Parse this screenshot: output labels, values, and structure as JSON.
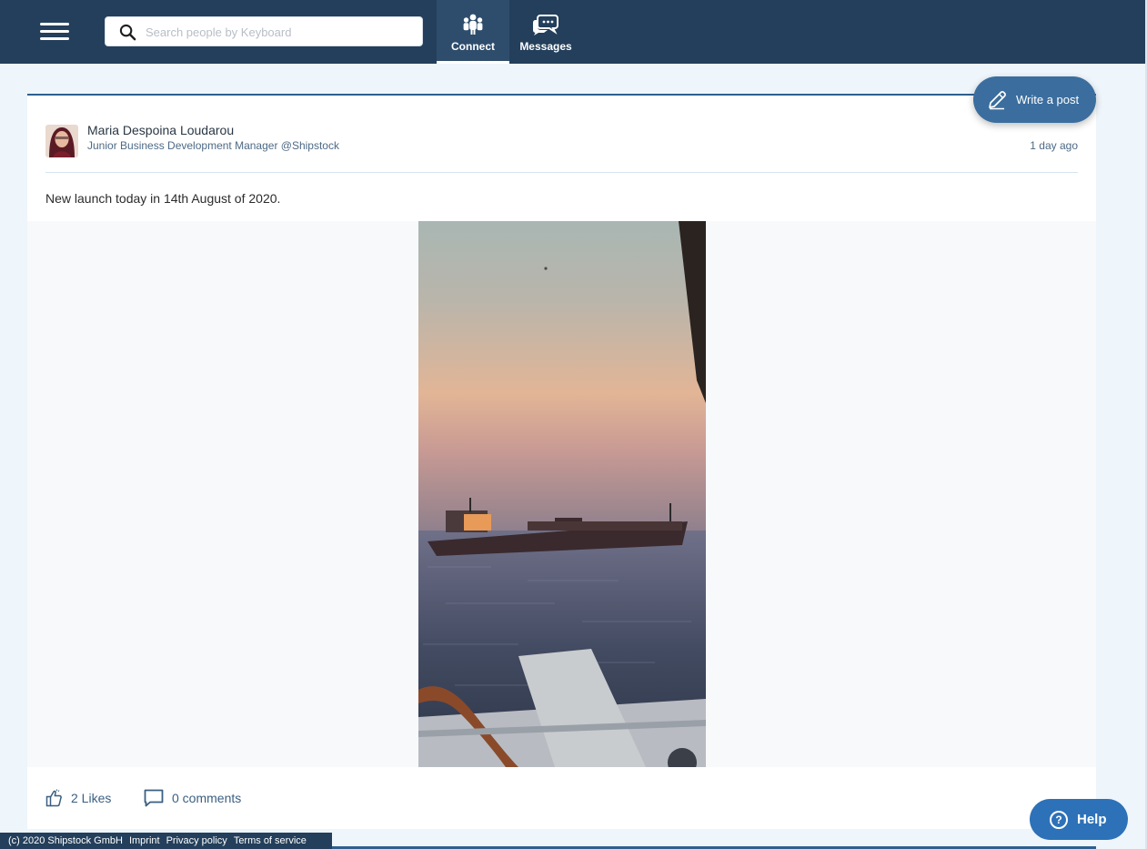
{
  "header": {
    "search_placeholder": "Search people by Keyboard",
    "tabs": [
      {
        "label": "Connect",
        "icon": "people-icon",
        "active": true
      },
      {
        "label": "Messages",
        "icon": "chat-bubbles-icon",
        "active": false
      }
    ]
  },
  "post": {
    "author": {
      "name": "Maria Despoina Loudarou",
      "title": "Junior Business Development Manager @Shipstock"
    },
    "time": "1 day ago",
    "text": "New launch today in 14th August of 2020.",
    "likes": "2 Likes",
    "comments": "0 comments"
  },
  "actions": {
    "write_post": "Write a post",
    "help": "Help"
  },
  "footer": {
    "copyright": "(c) 2020 Shipstock GmbH",
    "links": [
      "Imprint",
      "Privacy policy",
      "Terms of service"
    ]
  },
  "colors": {
    "topbar": "#233f5b",
    "accent": "#3b6e9e",
    "help": "#2d72b8",
    "page_bg": "#eef5fb"
  }
}
